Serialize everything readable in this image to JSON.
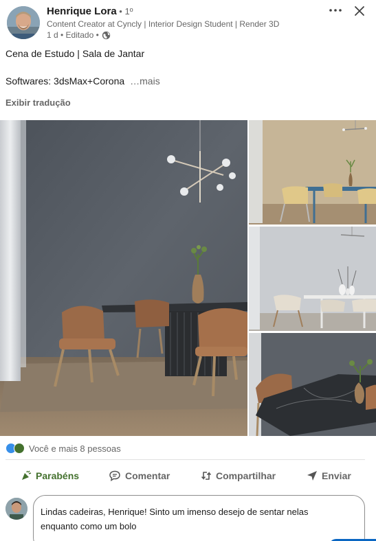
{
  "post": {
    "author_name": "Henrique Lora",
    "connection_degree": " • 1º",
    "headline": "Content Creator at Cyncly | Interior Design Student | Render 3D",
    "meta_text": "1 d • Editado •",
    "visibility_icon": "globe-icon",
    "text_line1": "Cena de Estudo | Sala de Jantar",
    "text_line2": "Softwares: 3dsMax+Corona",
    "see_more": "…mais",
    "translate_label": "Exibir tradução"
  },
  "reactions": {
    "summary": "Você e mais 8 pessoas",
    "icons": [
      "like-icon",
      "celebrate-icon"
    ]
  },
  "actions": {
    "celebrate": "Parabéns",
    "comment": "Comentar",
    "share": "Compartilhar",
    "send": "Enviar"
  },
  "comment": {
    "text_line1": "Lindas cadeiras, Henrique! Sinto um imenso desejo de sentar nelas",
    "text_line2": "enquanto como um bolo"
  },
  "colors": {
    "accent_green": "#44712e",
    "primary_blue": "#0a66c2"
  }
}
